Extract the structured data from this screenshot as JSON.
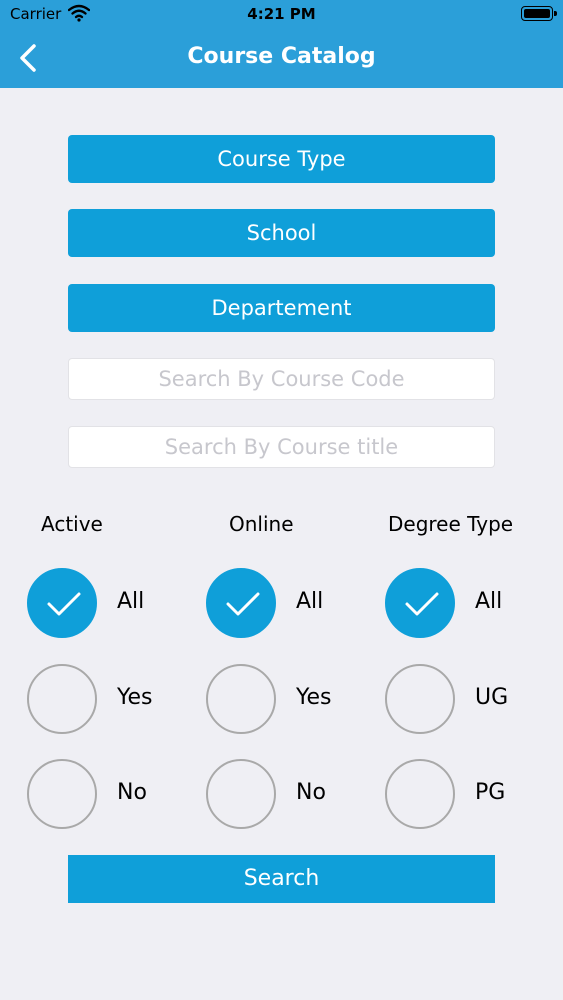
{
  "status_bar": {
    "carrier": "Carrier",
    "time": "4:21 PM"
  },
  "nav": {
    "title": "Course Catalog"
  },
  "filters": {
    "course_type": "Course Type",
    "school": "School",
    "department": "Departement"
  },
  "search_fields": {
    "code_placeholder": "Search By Course Code",
    "title_placeholder": "Search By Course title"
  },
  "groups": {
    "active": {
      "title": "Active",
      "options": [
        "All",
        "Yes",
        "No"
      ],
      "selected": "All"
    },
    "online": {
      "title": "Online",
      "options": [
        "All",
        "Yes",
        "No"
      ],
      "selected": "All"
    },
    "degree": {
      "title": "Degree Type",
      "options": [
        "All",
        "UG",
        "PG"
      ],
      "selected": "All"
    }
  },
  "search_button": "Search",
  "colors": {
    "accent": "#0f9fd9",
    "nav": "#2b9fd9",
    "background": "#efeff4"
  }
}
